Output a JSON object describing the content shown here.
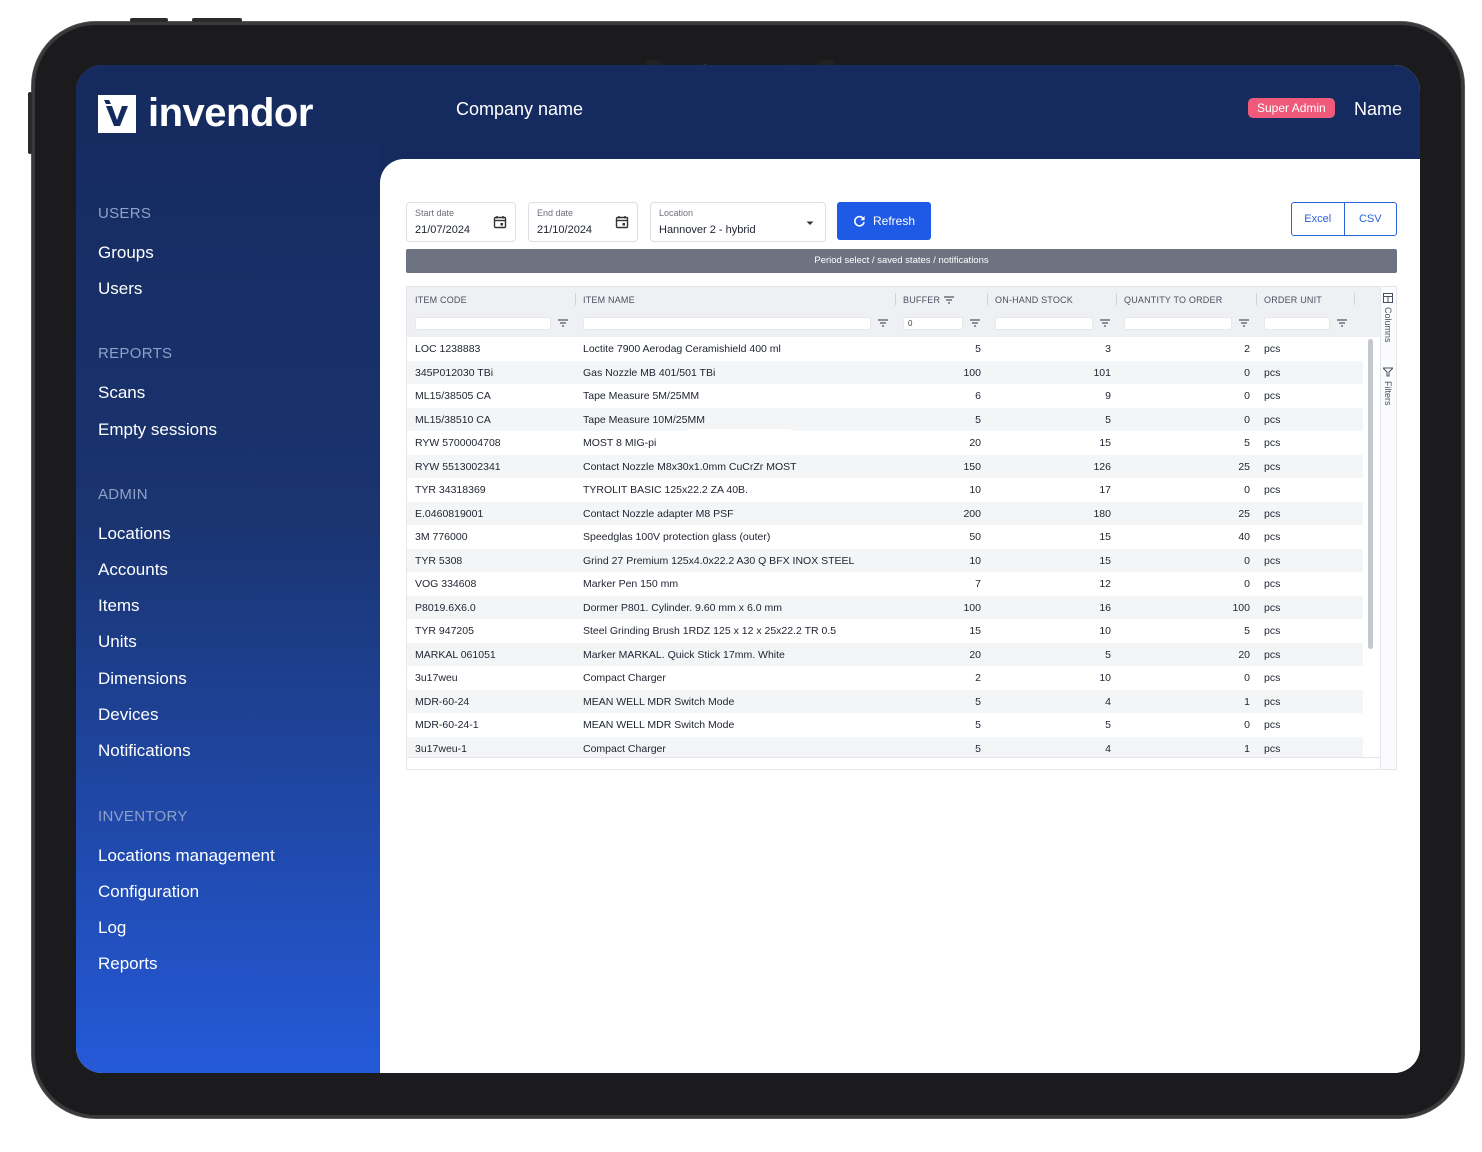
{
  "app": {
    "logo_text": "invendor",
    "company": "Company name",
    "role_badge": "Super Admin",
    "user_name": "Name"
  },
  "sidebar": {
    "users_section": "USERS",
    "users_items": [
      "Groups",
      "Users"
    ],
    "reports_section": "REPORTS",
    "reports_items": [
      "Scans",
      "Empty sessions"
    ],
    "admin_section": "ADMIN",
    "admin_items": [
      "Locations",
      "Accounts",
      "Items",
      "Units",
      "Dimensions",
      "Devices",
      "Notifications"
    ],
    "inventory_section": "INVENTORY",
    "inventory_items": [
      "Locations management",
      "Configuration",
      "Log",
      "Reports"
    ]
  },
  "filters": {
    "start_label": "Start date",
    "start_value": "21/07/2024",
    "end_label": "End date",
    "end_value": "21/10/2024",
    "location_label": "Location",
    "location_value": "Hannover 2 - hybrid",
    "refresh_label": "Refresh",
    "excel_label": "Excel",
    "csv_label": "CSV"
  },
  "period_bar": "Period select / saved states / notifications",
  "grid": {
    "columns": [
      "ITEM CODE",
      "ITEM NAME",
      "BUFFER",
      "ON-HAND STOCK",
      "QUANTITY TO ORDER",
      "ORDER UNIT"
    ],
    "buffer_filter_value": "0",
    "side_columns": "Columns",
    "side_filters": "Filters",
    "rows": [
      [
        "LOC 1238883",
        "Loctite 7900 Aerodag Ceramishield 400 ml",
        "5",
        "3",
        "2",
        "pcs"
      ],
      [
        "345P012030 TBi",
        "Gas Nozzle MB 401/501 TBi",
        "100",
        "101",
        "0",
        "pcs"
      ],
      [
        "ML15/38505 CA",
        "Tape Measure 5M/25MM",
        "6",
        "9",
        "0",
        "pcs"
      ],
      [
        "ML15/38510 CA",
        "Tape Measure 10M/25MM",
        "5",
        "5",
        "0",
        "pcs"
      ],
      [
        "RYW 5700004708",
        "MOST 8 MIG-pi",
        "20",
        "15",
        "5",
        "pcs"
      ],
      [
        "RYW 5513002341",
        "Contact Nozzle M8x30x1.0mm CuCrZr MOST",
        "150",
        "126",
        "25",
        "pcs"
      ],
      [
        "TYR 34318369",
        "TYROLIT BASIC 125x22.2 ZA 40B.",
        "10",
        "17",
        "0",
        "pcs"
      ],
      [
        "E.0460819001",
        "Contact Nozzle adapter M8 PSF",
        "200",
        "180",
        "25",
        "pcs"
      ],
      [
        "3M 776000",
        "Speedglas 100V protection glass (outer)",
        "50",
        "15",
        "40",
        "pcs"
      ],
      [
        "TYR 5308",
        "Grind 27 Premium 125x4.0x22.2 A30 Q BFX INOX STEEL",
        "10",
        "15",
        "0",
        "pcs"
      ],
      [
        "VOG 334608",
        "Marker Pen 150 mm",
        "7",
        "12",
        "0",
        "pcs"
      ],
      [
        "P8019.6X6.0",
        "Dormer P801. Cylinder. 9.60 mm x 6.0 mm",
        "100",
        "16",
        "100",
        "pcs"
      ],
      [
        "TYR 947205",
        "Steel Grinding Brush 1RDZ 125 x 12 x 25x22.2 TR 0.5",
        "15",
        "10",
        "5",
        "pcs"
      ],
      [
        "MARKAL 061051",
        "Marker MARKAL. Quick Stick 17mm. White",
        "20",
        "5",
        "20",
        "pcs"
      ],
      [
        "3u17weu",
        "Compact Charger",
        "2",
        "10",
        "0",
        "pcs"
      ],
      [
        "MDR-60-24",
        "MEAN WELL MDR Switch Mode",
        "5",
        "4",
        "1",
        "pcs"
      ],
      [
        "MDR-60-24-1",
        "MEAN WELL MDR Switch Mode",
        "5",
        "5",
        "0",
        "pcs"
      ],
      [
        "3u17weu-1",
        "Compact Charger",
        "5",
        "4",
        "1",
        "pcs"
      ]
    ]
  },
  "colors": {
    "header": "#152a5e",
    "accent": "#1f5ae6",
    "badge": "#ef5a7a"
  }
}
